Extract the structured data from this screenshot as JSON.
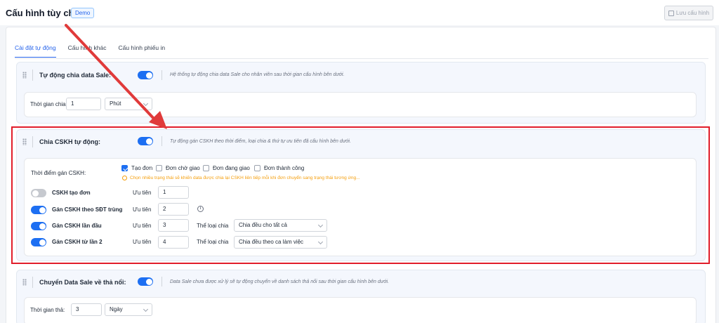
{
  "header": {
    "title": "Cấu hình tùy chỉnh",
    "badge": "Demo",
    "save_label": "Lưu cấu hình"
  },
  "tabs": [
    {
      "label": "Cài đặt tự động",
      "active": true
    },
    {
      "label": "Cấu hình khác",
      "active": false
    },
    {
      "label": "Cấu hình phiếu in",
      "active": false
    }
  ],
  "section1": {
    "title": "Tự động chia data Sale:",
    "enabled": true,
    "description": "Hệ thống tự động chia data Sale cho nhân viên sau thời gian cấu hình bên dưới.",
    "time_label": "Thời gian chia",
    "time_value": "1",
    "unit": "Phút"
  },
  "section2": {
    "title": "Chia CSKH tự động:",
    "enabled": true,
    "description": "Tự động gán CSKH theo thời điểm, loại chia & thứ tự ưu tiên đã cấu hình bên dưới.",
    "time_point_label": "Thời điểm gán CSKH:",
    "checkboxes": [
      {
        "label": "Tạo đơn",
        "checked": true
      },
      {
        "label": "Đơn chờ giao",
        "checked": false
      },
      {
        "label": "Đơn đang giao",
        "checked": false
      },
      {
        "label": "Đơn thành công",
        "checked": false
      }
    ],
    "warning": "Chọn nhiều trạng thái sẽ khiến data được chia lại CSKH liên tiếp mỗi khi đơn chuyển sang trạng thái tương ứng...",
    "priority_label": "Ưu tiên",
    "type_label": "Thể loại chia",
    "rows": [
      {
        "label": "CSKH tạo đơn",
        "enabled": false,
        "priority": "1"
      },
      {
        "label": "Gán CSKH theo SĐT trùng",
        "enabled": true,
        "priority": "2",
        "info_icon": "info-icon"
      },
      {
        "label": "Gán CSKH lần đầu",
        "enabled": true,
        "priority": "3",
        "type": "Chia đều cho tất cả"
      },
      {
        "label": "Gán CSKH từ lần 2",
        "enabled": true,
        "priority": "4",
        "type": "Chia đều theo ca làm việc"
      }
    ]
  },
  "section3": {
    "title": "Chuyển Data Sale về thả nổi:",
    "enabled": true,
    "description": "Data Sale chưa được xử lý sẽ tự động chuyển về danh sách thả nổi sau thời gian cấu hình bên dưới.",
    "time_label": "Thời gian thả:",
    "time_value": "3",
    "unit": "Ngày"
  },
  "colors": {
    "accent": "#1d6ff2",
    "highlight": "#e11d2a",
    "warning": "#f59e0b"
  }
}
